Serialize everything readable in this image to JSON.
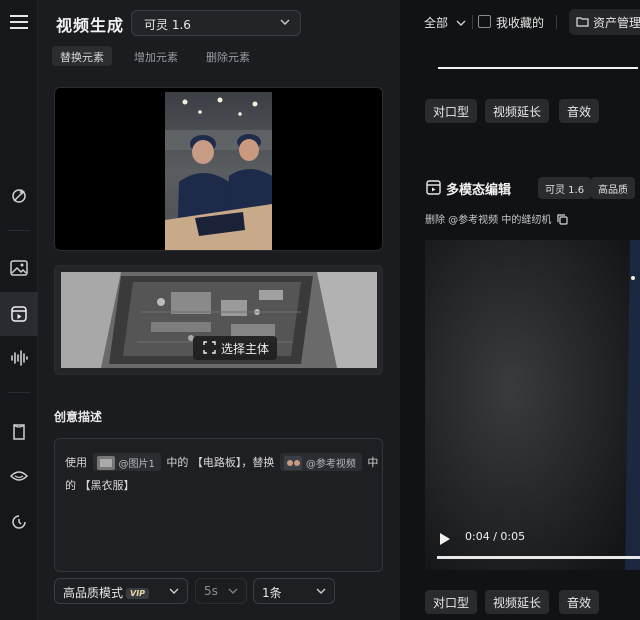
{
  "header": {
    "title": "视频生成",
    "model_select": "可灵 1.6"
  },
  "tabs": [
    {
      "label": "替换元素",
      "active": true
    },
    {
      "label": "增加元素",
      "active": false
    },
    {
      "label": "删除元素",
      "active": false
    }
  ],
  "subject_button": "选择主体",
  "section_title": "创意描述",
  "prompt": {
    "t1": "使用",
    "chip1": "@图片1",
    "t2": "中的 【电路板】，替换",
    "chip2": "@参考视频",
    "t3": "中",
    "t4": "的 【黑衣服】"
  },
  "bottom": {
    "quality": "高品质模式",
    "vip": "VIP",
    "duration": "5s",
    "count": "1条"
  },
  "right": {
    "filter_all": "全部",
    "favorites": "我收藏的",
    "assets": "资产管理",
    "actions": [
      "对口型",
      "视频延长",
      "音效"
    ],
    "mm_title": "多模态编辑",
    "tag_model": "可灵 1.6",
    "tag_quality": "高品质",
    "desc": "删除 @参考视频 中的缝纫机",
    "video_time": "0:04 / 0:05",
    "video_progress": 0.8
  },
  "colors": {
    "background": "#0f1012",
    "panel": "#1b1c1f",
    "chip": "#2c2d31",
    "vip_text": "#e8d9a8"
  }
}
